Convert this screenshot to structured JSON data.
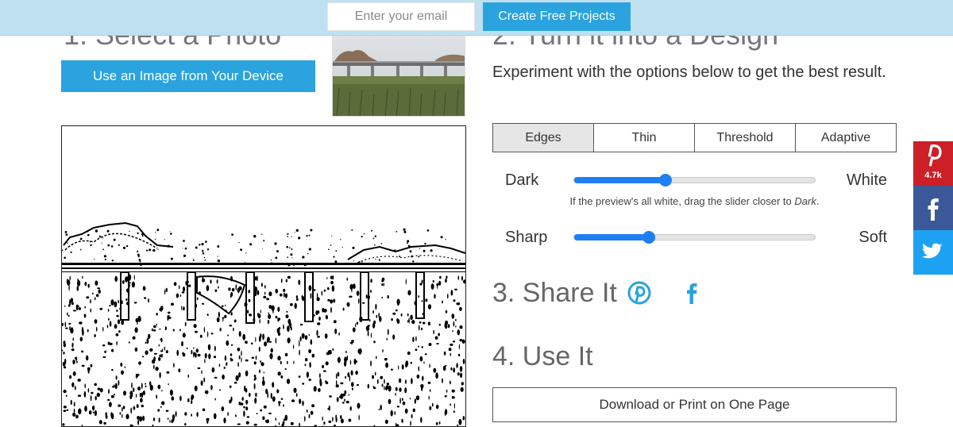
{
  "topbar": {
    "email_placeholder": "Enter your email",
    "create_button": "Create Free Projects"
  },
  "step1": {
    "heading": "1. Select a Photo",
    "upload_button": "Use an Image from Your Device"
  },
  "step2": {
    "heading": "2. Turn it into a Design",
    "description": "Experiment with the options below to get the best result.",
    "tabs": [
      {
        "label": "Edges",
        "active": true
      },
      {
        "label": "Thin",
        "active": false
      },
      {
        "label": "Threshold",
        "active": false
      },
      {
        "label": "Adaptive",
        "active": false
      }
    ],
    "sliders": {
      "dark_white": {
        "left_label": "Dark",
        "right_label": "White",
        "value": 0.38
      },
      "sharp_soft": {
        "left_label": "Sharp",
        "right_label": "Soft",
        "value": 0.31
      }
    },
    "hint_prefix": "If the preview's all white, drag the slider closer to ",
    "hint_emphasis": "Dark",
    "hint_suffix": "."
  },
  "step3": {
    "heading": "3. Share It",
    "icons": [
      "pinterest-icon",
      "facebook-icon"
    ]
  },
  "step4": {
    "heading": "4. Use It",
    "download_button": "Download or Print on One Page"
  },
  "social_bar": {
    "pinterest_count": "4.7k"
  },
  "colors": {
    "topbar_bg": "#bfe0f1",
    "accent_blue": "#2aa3de",
    "slider_blue": "#1e7ff5",
    "pinterest_red": "#cb2027",
    "facebook_blue": "#3b5998",
    "twitter_blue": "#1da1f2"
  }
}
